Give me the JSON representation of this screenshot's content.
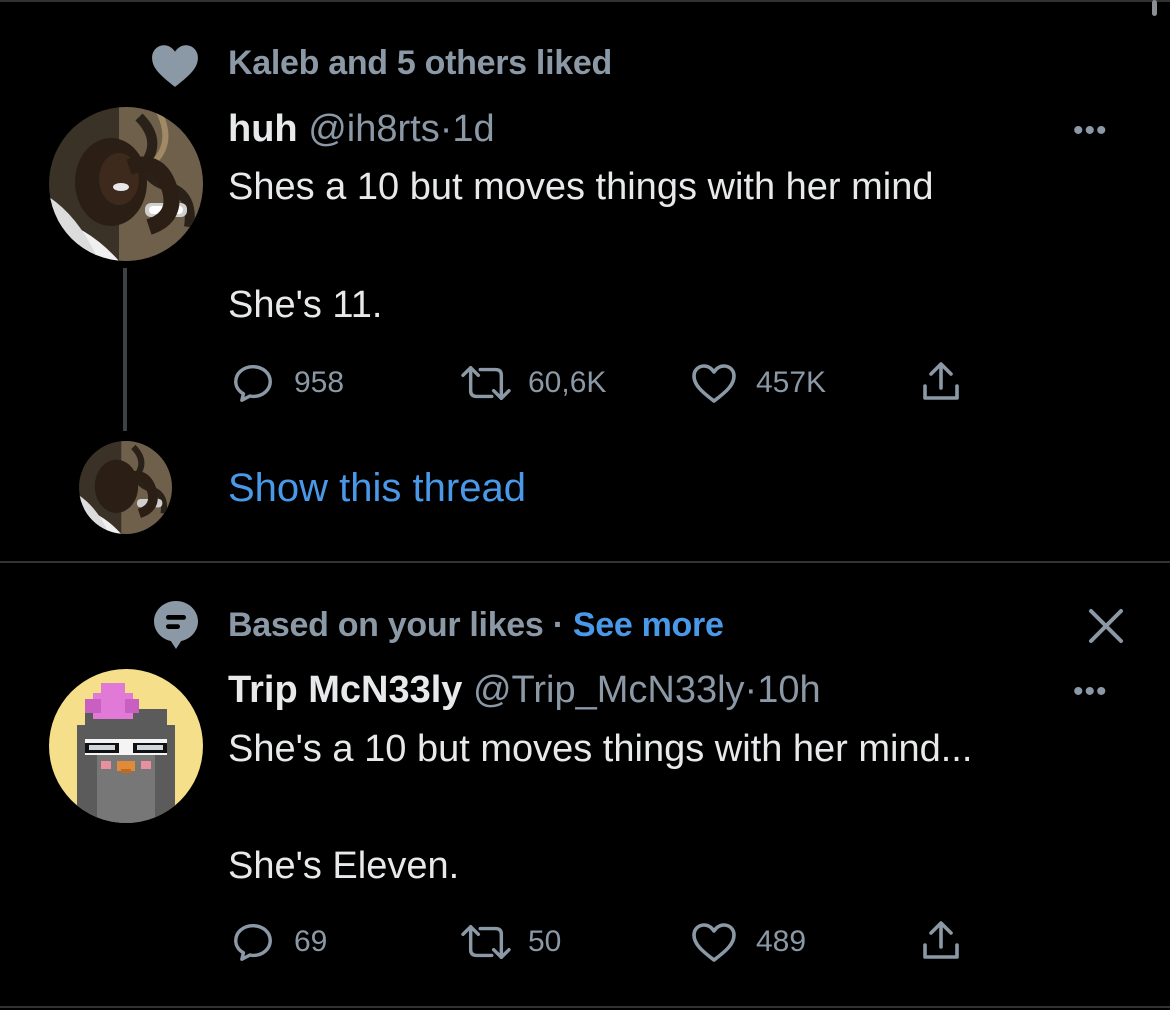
{
  "tweet1": {
    "social_context": "Kaleb and 5 others liked",
    "display_name": "huh",
    "handle": "@ih8rts",
    "time": "1d",
    "separator": "·",
    "text_line1": "Shes a 10 but moves things with her mind",
    "text_line2": "She's 11.",
    "replies": "958",
    "retweets": "60,6K",
    "likes": "457K",
    "more_label": "•••"
  },
  "thread": {
    "show_thread": "Show this thread"
  },
  "tweet2": {
    "context_text": "Based on your likes",
    "context_separator": "·",
    "context_link": "See more",
    "display_name": "Trip McN33ly",
    "handle": "@Trip_McN33ly",
    "time": "10h",
    "separator": "·",
    "text_line1": "She's a 10 but moves things with her mind...",
    "text_line2": "She's Eleven.",
    "replies": "69",
    "retweets": "50",
    "likes": "489",
    "more_label": "•••"
  },
  "icons": {
    "heart": "heart-icon",
    "reply": "reply-icon",
    "retweet": "retweet-icon",
    "like": "like-icon",
    "share": "share-icon",
    "topic": "topic-icon",
    "close": "close-icon"
  },
  "colors": {
    "background": "#000000",
    "text": "#e7e9ea",
    "muted": "#8b98a5",
    "link": "#4a99e9",
    "divider": "#2f3336"
  }
}
